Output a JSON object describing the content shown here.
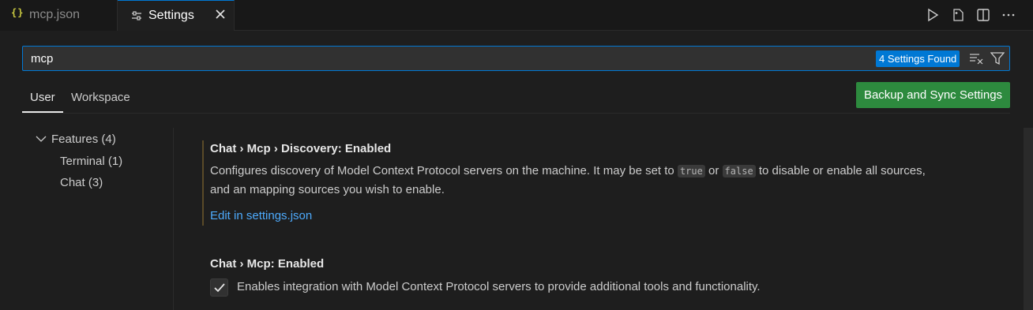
{
  "tabs": {
    "mcp_json": {
      "icon": "{}",
      "label": "mcp.json"
    },
    "settings": {
      "label": "Settings"
    }
  },
  "search": {
    "value": "mcp",
    "results_badge": "4 Settings Found"
  },
  "scopes": {
    "user": "User",
    "workspace": "Workspace"
  },
  "sync_button": "Backup and Sync Settings",
  "toc": {
    "features": "Features (4)",
    "terminal": "Terminal (1)",
    "chat": "Chat (3)"
  },
  "settings": {
    "discovery": {
      "title": "Chat › Mcp › Discovery: Enabled",
      "desc_part1": "Configures discovery of Model Context Protocol servers on the machine. It may be set to ",
      "code_true": "true",
      "desc_or": " or ",
      "code_false": "false",
      "desc_part2": " to disable or enable all sources,",
      "desc_line2": "and an mapping sources you wish to enable.",
      "edit_link": "Edit in settings.json"
    },
    "mcp_enabled": {
      "title": "Chat › Mcp: Enabled",
      "checked": true,
      "desc": "Enables integration with Model Context Protocol servers to provide additional tools and functionality."
    }
  },
  "colors": {
    "accent": "#0078d4",
    "sync_button": "#2d8a3e",
    "link": "#4daafc",
    "json_icon": "#cbcb41"
  }
}
